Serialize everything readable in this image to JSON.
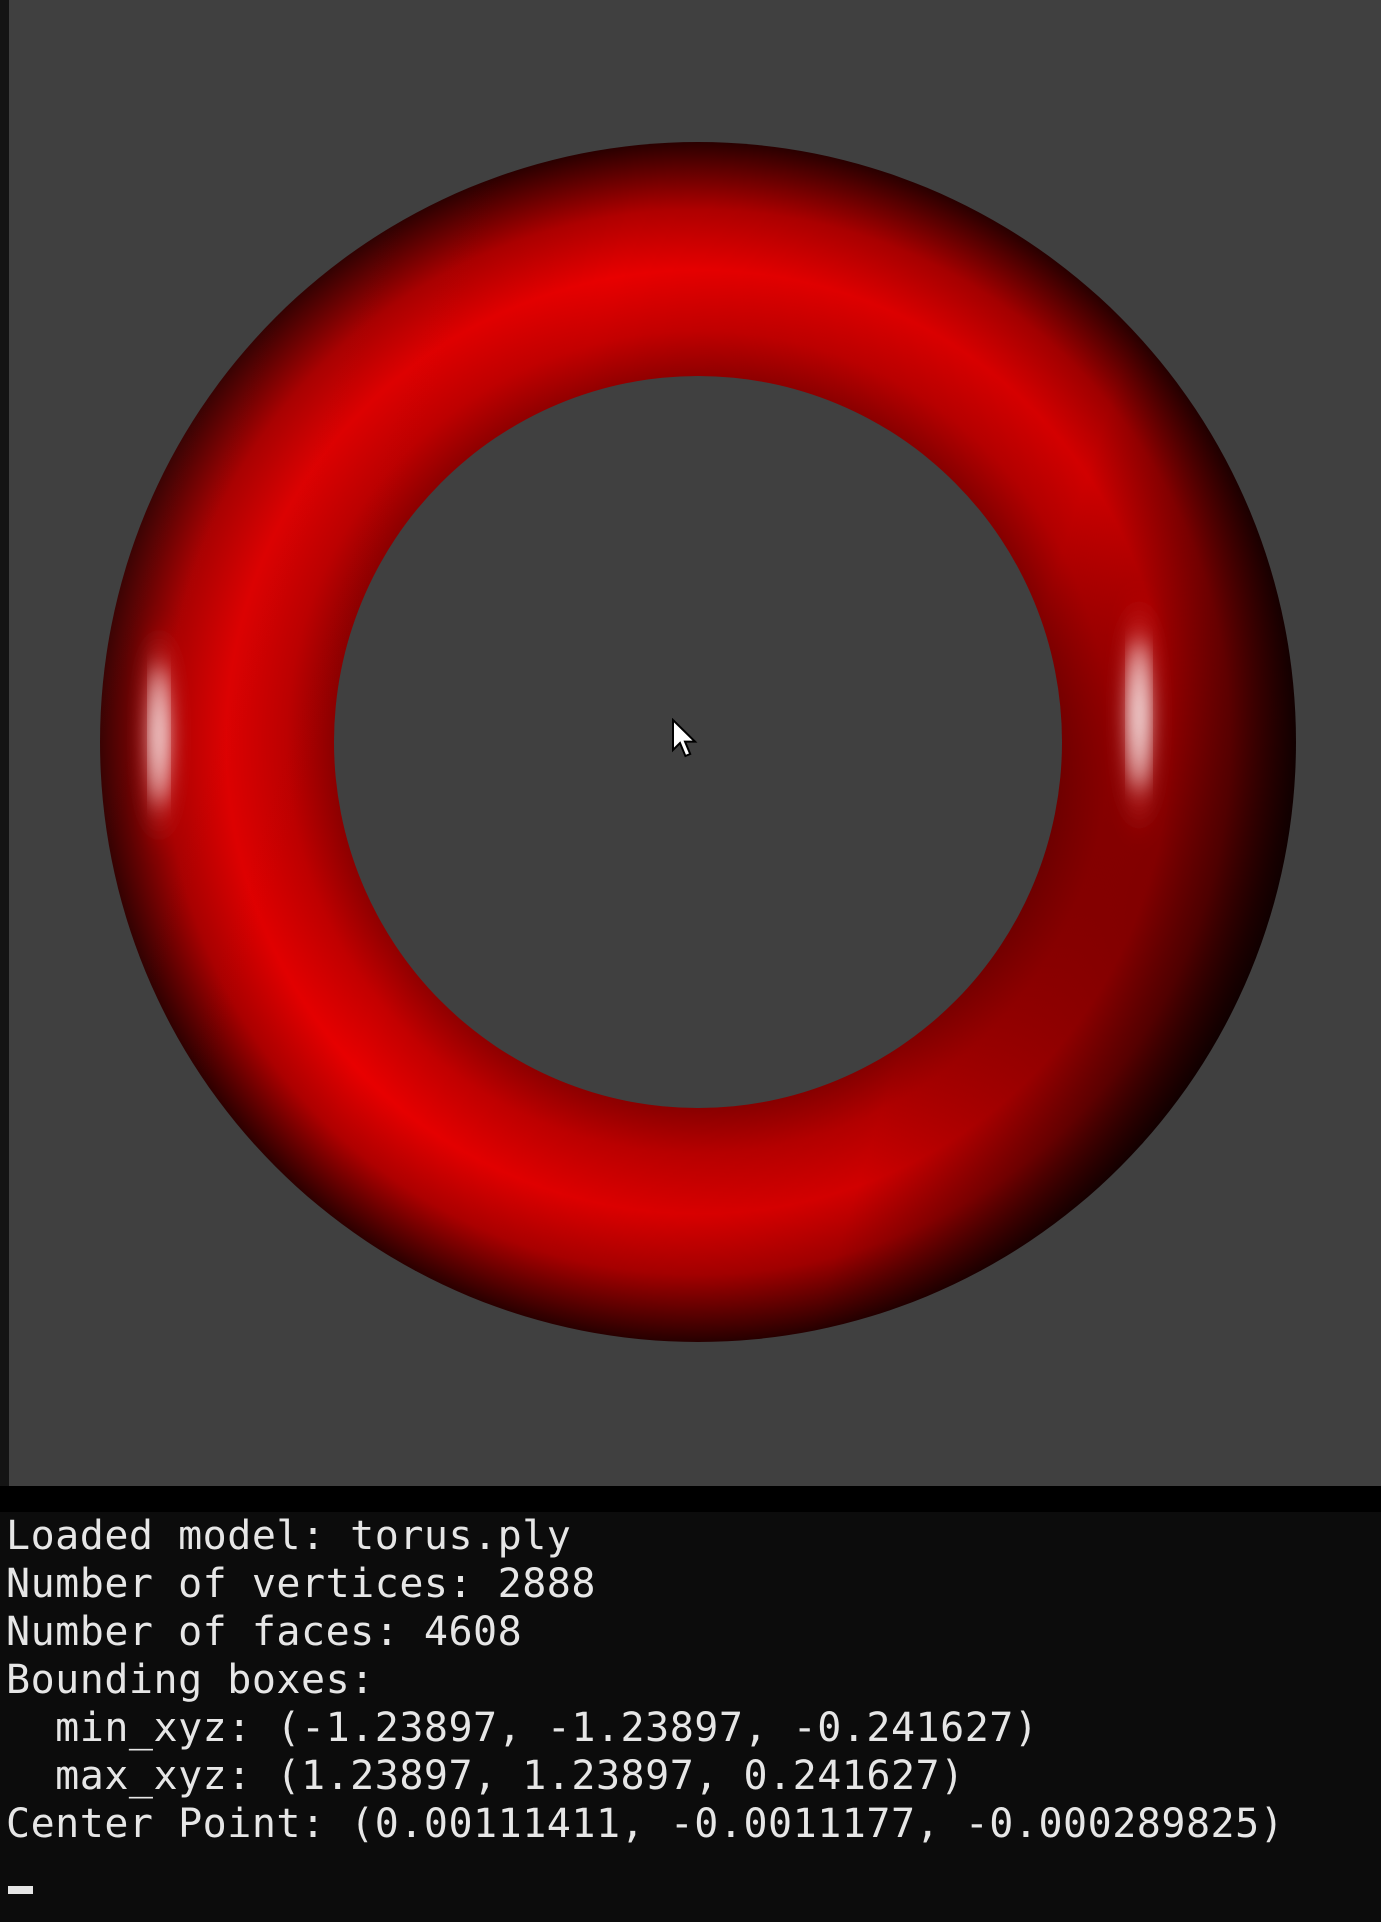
{
  "viewport": {
    "background_color": "#404040",
    "model_color": "#e00000",
    "highlight_color": "#ffffff",
    "shadow_color": "#000000",
    "shape": "torus"
  },
  "console": {
    "lines": [
      "Loaded model: torus.ply",
      "Number of vertices: 2888",
      "Number of faces: 4608",
      "Bounding boxes:",
      "  min_xyz: (-1.23897, -1.23897, -0.241627)",
      "  max_xyz: (1.23897, 1.23897, 0.241627)",
      "Center Point: (0.00111411, -0.0011177, -0.000289825)"
    ],
    "text_color": "#e6e6e6",
    "background_color": "#0c0c0c"
  }
}
